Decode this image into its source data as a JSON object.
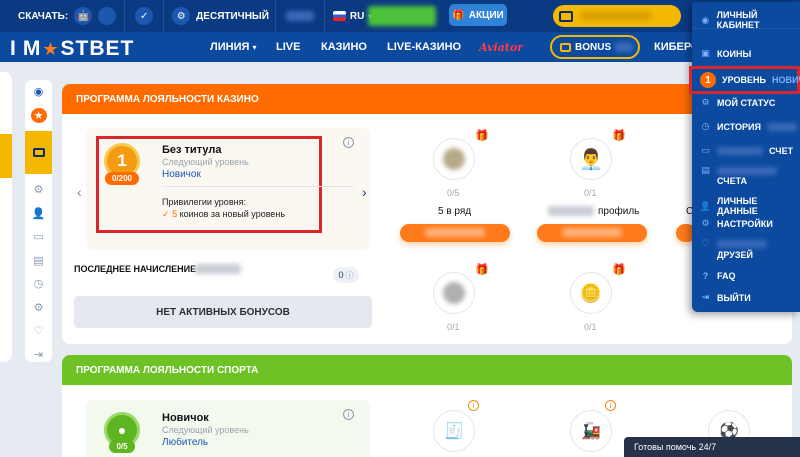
{
  "topbar": {
    "download_label": "СКАЧАТЬ:",
    "odds_format": "ДЕСЯТИЧНЫЙ",
    "language": "RU",
    "promo_label": "АКЦИИ"
  },
  "logo": {
    "left": "I",
    "star": "★",
    "right": "STBET",
    "pre": "M"
  },
  "nav": {
    "items": [
      "ЛИНИЯ",
      "LIVE",
      "КАЗИНО",
      "LIVE-КАЗИНО",
      "Aviator"
    ],
    "bonus_label": "BONUS",
    "cyber_label": "КИБЕРС"
  },
  "casino": {
    "header": "ПРОГРАММА ЛОЯЛЬНОСТИ КАЗИНО",
    "level_number": "1",
    "level_progress": "0/200",
    "level_title": "Без титула",
    "next_level_caption": "Следующий уровень",
    "next_level_name": "Новичок",
    "privileges_title": "Привилегии уровня:",
    "privilege_amount": "5",
    "privilege_text": "коинов за новый уровень",
    "last_accrual_label": "ПОСЛЕДНЕЕ НАЧИСЛЕНИЕ",
    "last_accrual_value": "0",
    "no_bonuses": "НЕТ АКТИВНЫХ БОНУСОВ",
    "tasks": [
      {
        "count": "0/5",
        "label": "5 в ряд"
      },
      {
        "count": "0/1",
        "label": "профиль"
      },
      {
        "count": "С",
        "label": ""
      },
      {
        "count": "0/1",
        "label": ""
      },
      {
        "count": "0/1",
        "label": ""
      }
    ]
  },
  "sport": {
    "header": "ПРОГРАММА ЛОЯЛЬНОСТИ СПОРТА",
    "level_title": "Новичок",
    "level_progress": "0/5",
    "next_level_caption": "Следующий уровень",
    "next_level_name": "Любитель"
  },
  "account_menu": {
    "title": "ЛИЧНЫЙ КАБИНЕТ",
    "items": [
      {
        "label": "КОИНЫ"
      },
      {
        "label": "УРОВЕНЬ",
        "badge": "1",
        "value": "НОВИЧОК"
      },
      {
        "label": "МОЙ СТАТУС"
      },
      {
        "label": "ИСТОРИЯ"
      },
      {
        "label": "СЧЕТ"
      },
      {
        "label": "СЧЕТА"
      },
      {
        "label": "ЛИЧНЫЕ ДАННЫЕ"
      },
      {
        "label": "НАСТРОЙКИ"
      },
      {
        "label": "ДРУЗЕЙ"
      },
      {
        "label": "FAQ"
      },
      {
        "label": "ВЫЙТИ"
      }
    ]
  },
  "chat": {
    "label": "Готовы помочь 24/7"
  },
  "colors": {
    "brand_blue": "#0c4a9f",
    "casino_header": "#ff6b00",
    "sport_header": "#6ec226",
    "accent_yellow": "#f5b800",
    "highlight_red": "#d9252b"
  }
}
